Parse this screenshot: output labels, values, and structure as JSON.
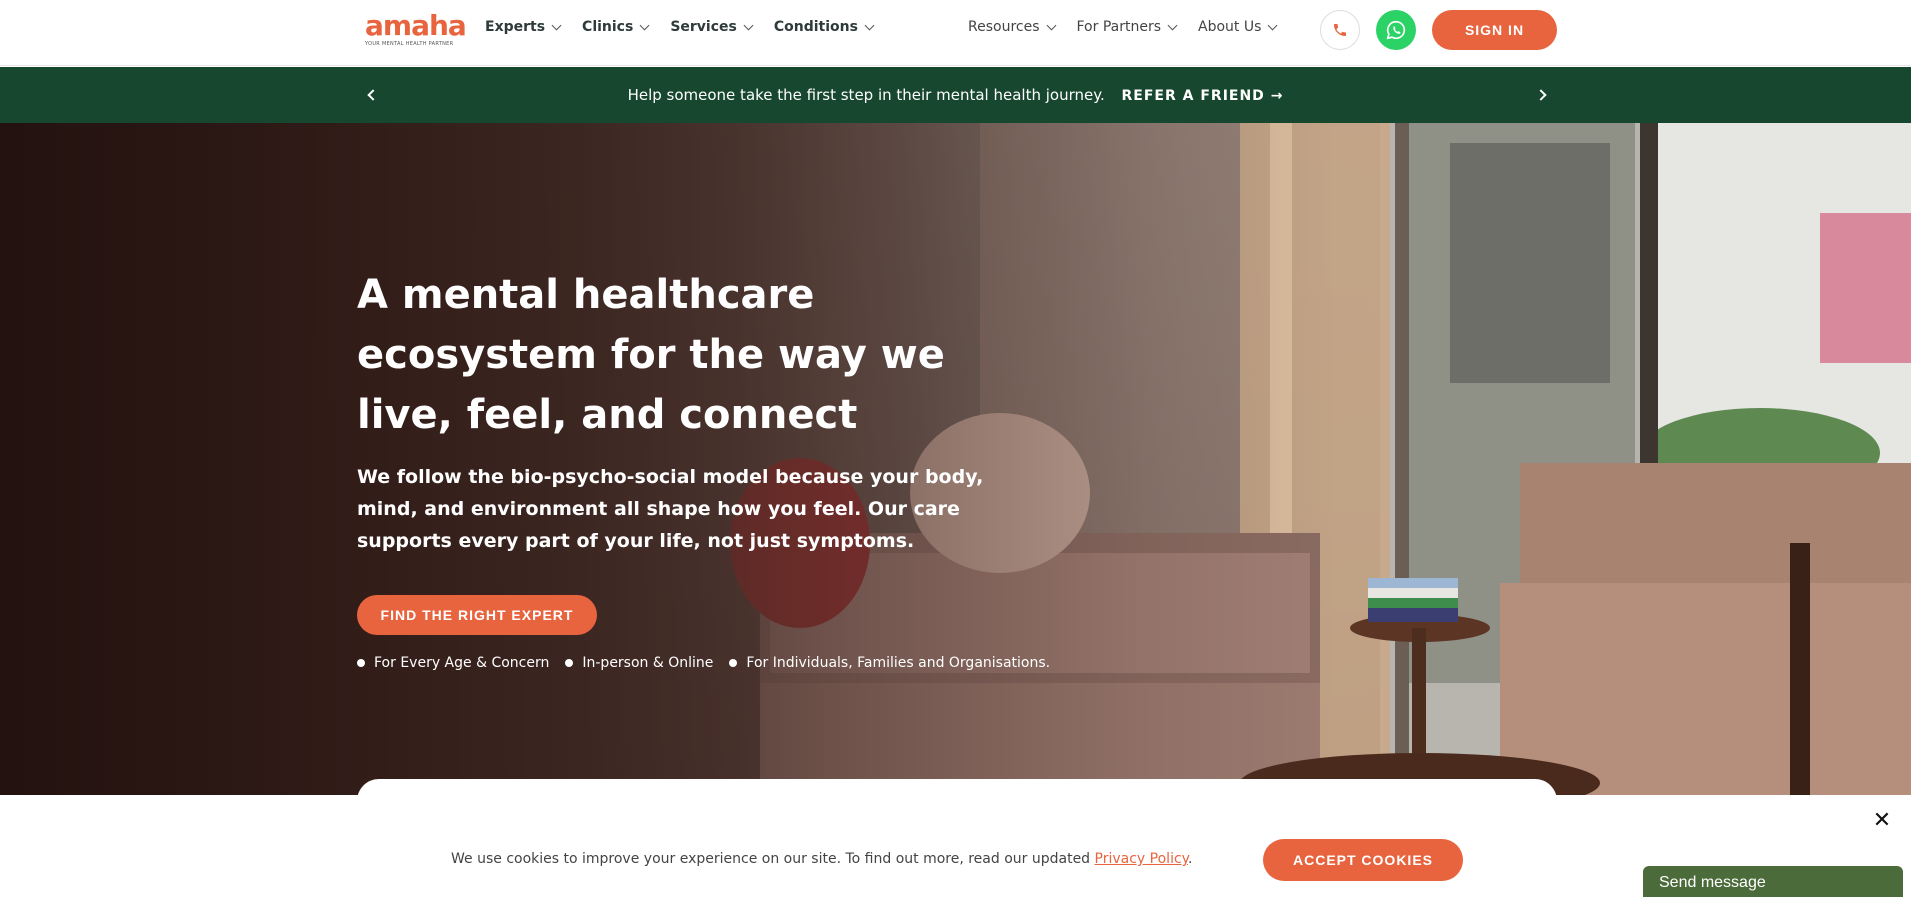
{
  "header": {
    "logo_text": "amaha",
    "logo_tagline": "YOUR MENTAL HEALTH PARTNER",
    "nav_left": [
      {
        "label": "Experts"
      },
      {
        "label": "Clinics"
      },
      {
        "label": "Services"
      },
      {
        "label": "Conditions"
      }
    ],
    "nav_right": [
      {
        "label": "Resources"
      },
      {
        "label": "For Partners"
      },
      {
        "label": "About Us"
      }
    ],
    "phone_icon": "phone-icon",
    "whatsapp_icon": "whatsapp-icon",
    "sign_in_label": "SIGN IN"
  },
  "announcement": {
    "message": "Help someone take the first step in their mental health journey.",
    "link_label": "REFER A FRIEND",
    "link_icon": "arrow-right-icon"
  },
  "hero": {
    "title": "A mental healthcare ecosystem for the way we live, feel, and connect",
    "subtitle": "We follow the bio-psycho-social model because your body, mind, and environment all shape how you feel. Our care supports every part of your life, not just symptoms.",
    "cta_label": "FIND THE RIGHT EXPERT",
    "bullets": [
      "For Every Age & Concern",
      "In-person & Online",
      "For Individuals, Families and Organisations."
    ]
  },
  "cookie": {
    "message": "We use cookies to improve your experience on our site. To find out more, read our updated",
    "link_label": "Privacy Policy",
    "suffix": ".",
    "accept_label": "ACCEPT COOKIES",
    "close_label": "✕"
  },
  "chat": {
    "send_message_label": "Send message"
  },
  "colors": {
    "brand": "#e8643f",
    "announcement_bg": "#17472e",
    "whatsapp": "#2bd366",
    "chat_bg": "#4b6b3a"
  }
}
